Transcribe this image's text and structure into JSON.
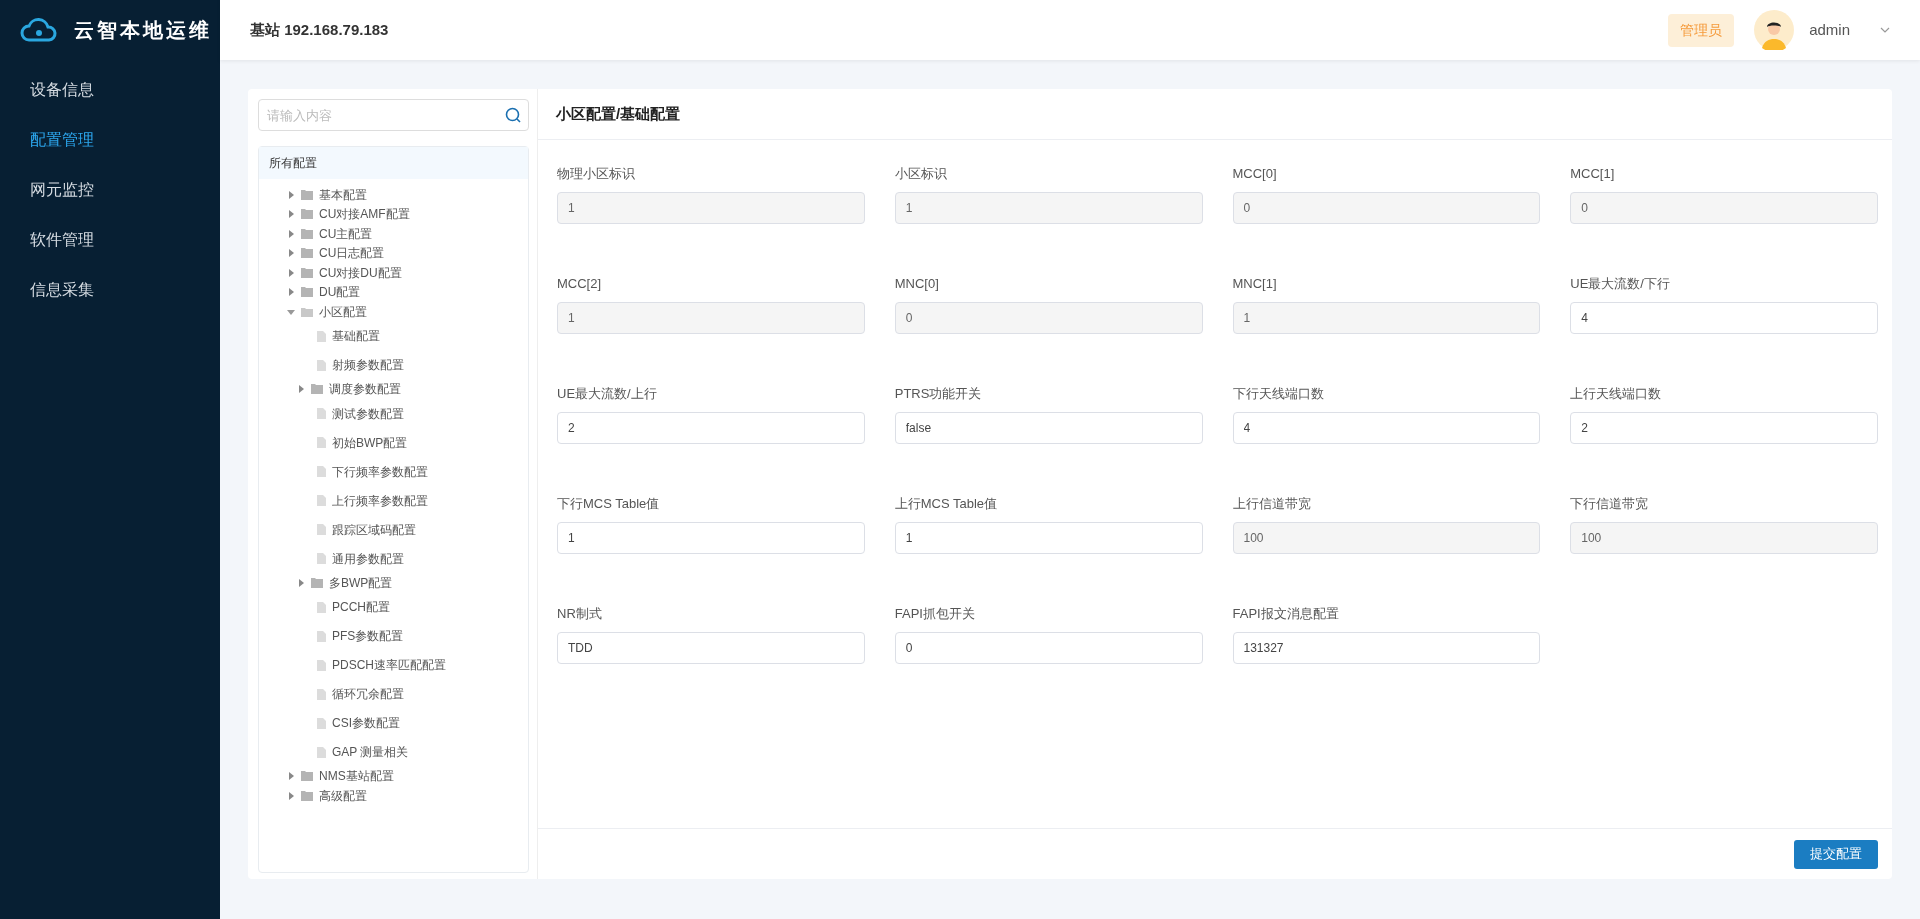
{
  "app": {
    "title": "云智本地运维"
  },
  "nav": [
    {
      "label": "设备信息",
      "selected": false
    },
    {
      "label": "配置管理",
      "selected": true
    },
    {
      "label": "网元监控",
      "selected": false
    },
    {
      "label": "软件管理",
      "selected": false
    },
    {
      "label": "信息采集",
      "selected": false
    }
  ],
  "header": {
    "station": "基站 192.168.79.183",
    "role": "管理员",
    "user": "admin"
  },
  "tree_search": {
    "placeholder": "请输入内容"
  },
  "tree": {
    "root": "所有配置",
    "items": [
      {
        "label": "基本配置",
        "kind": "folder",
        "expanded": false
      },
      {
        "label": "CU对接AMF配置",
        "kind": "folder",
        "expanded": false
      },
      {
        "label": "CU主配置",
        "kind": "folder",
        "expanded": false
      },
      {
        "label": "CU日志配置",
        "kind": "folder",
        "expanded": false
      },
      {
        "label": "CU对接DU配置",
        "kind": "folder",
        "expanded": false
      },
      {
        "label": "DU配置",
        "kind": "folder",
        "expanded": false
      },
      {
        "label": "小区配置",
        "kind": "folder",
        "expanded": true,
        "children": [
          {
            "label": "基础配置",
            "kind": "file"
          },
          {
            "label": "射频参数配置",
            "kind": "file"
          },
          {
            "label": "调度参数配置",
            "kind": "folder",
            "expanded": false
          },
          {
            "label": "测试参数配置",
            "kind": "file"
          },
          {
            "label": "初始BWP配置",
            "kind": "file"
          },
          {
            "label": "下行频率参数配置",
            "kind": "file"
          },
          {
            "label": "上行频率参数配置",
            "kind": "file"
          },
          {
            "label": "跟踪区域码配置",
            "kind": "file"
          },
          {
            "label": "通用参数配置",
            "kind": "file"
          },
          {
            "label": "多BWP配置",
            "kind": "folder",
            "expanded": false
          },
          {
            "label": "PCCH配置",
            "kind": "file"
          },
          {
            "label": "PFS参数配置",
            "kind": "file"
          },
          {
            "label": "PDSCH速率匹配配置",
            "kind": "file"
          },
          {
            "label": "循环冗余配置",
            "kind": "file"
          },
          {
            "label": "CSI参数配置",
            "kind": "file"
          },
          {
            "label": "GAP 测量相关",
            "kind": "file"
          }
        ]
      },
      {
        "label": "NMS基站配置",
        "kind": "folder",
        "expanded": false
      },
      {
        "label": "高级配置",
        "kind": "folder",
        "expanded": false
      }
    ]
  },
  "form": {
    "title": "小区配置/基础配置",
    "fields": [
      {
        "label": "物理小区标识",
        "value": "1",
        "disabled": true
      },
      {
        "label": "小区标识",
        "value": "1",
        "disabled": true
      },
      {
        "label": "MCC[0]",
        "value": "0",
        "disabled": true
      },
      {
        "label": "MCC[1]",
        "value": "0",
        "disabled": true
      },
      {
        "label": "MCC[2]",
        "value": "1",
        "disabled": true
      },
      {
        "label": "MNC[0]",
        "value": "0",
        "disabled": true
      },
      {
        "label": "MNC[1]",
        "value": "1",
        "disabled": true
      },
      {
        "label": "UE最大流数/下行",
        "value": "4",
        "disabled": false
      },
      {
        "label": "UE最大流数/上行",
        "value": "2",
        "disabled": false
      },
      {
        "label": "PTRS功能开关",
        "value": "false",
        "disabled": false
      },
      {
        "label": "下行天线端口数",
        "value": "4",
        "disabled": false
      },
      {
        "label": "上行天线端口数",
        "value": "2",
        "disabled": false
      },
      {
        "label": "下行MCS Table值",
        "value": "1",
        "disabled": false
      },
      {
        "label": "上行MCS Table值",
        "value": "1",
        "disabled": false
      },
      {
        "label": "上行信道带宽",
        "value": "100",
        "disabled": true
      },
      {
        "label": "下行信道带宽",
        "value": "100",
        "disabled": true
      },
      {
        "label": "NR制式",
        "value": "TDD",
        "disabled": false
      },
      {
        "label": "FAPI抓包开关",
        "value": "0",
        "disabled": false
      },
      {
        "label": "FAPI报文消息配置",
        "value": "131327",
        "disabled": false
      }
    ],
    "submit": "提交配置"
  }
}
